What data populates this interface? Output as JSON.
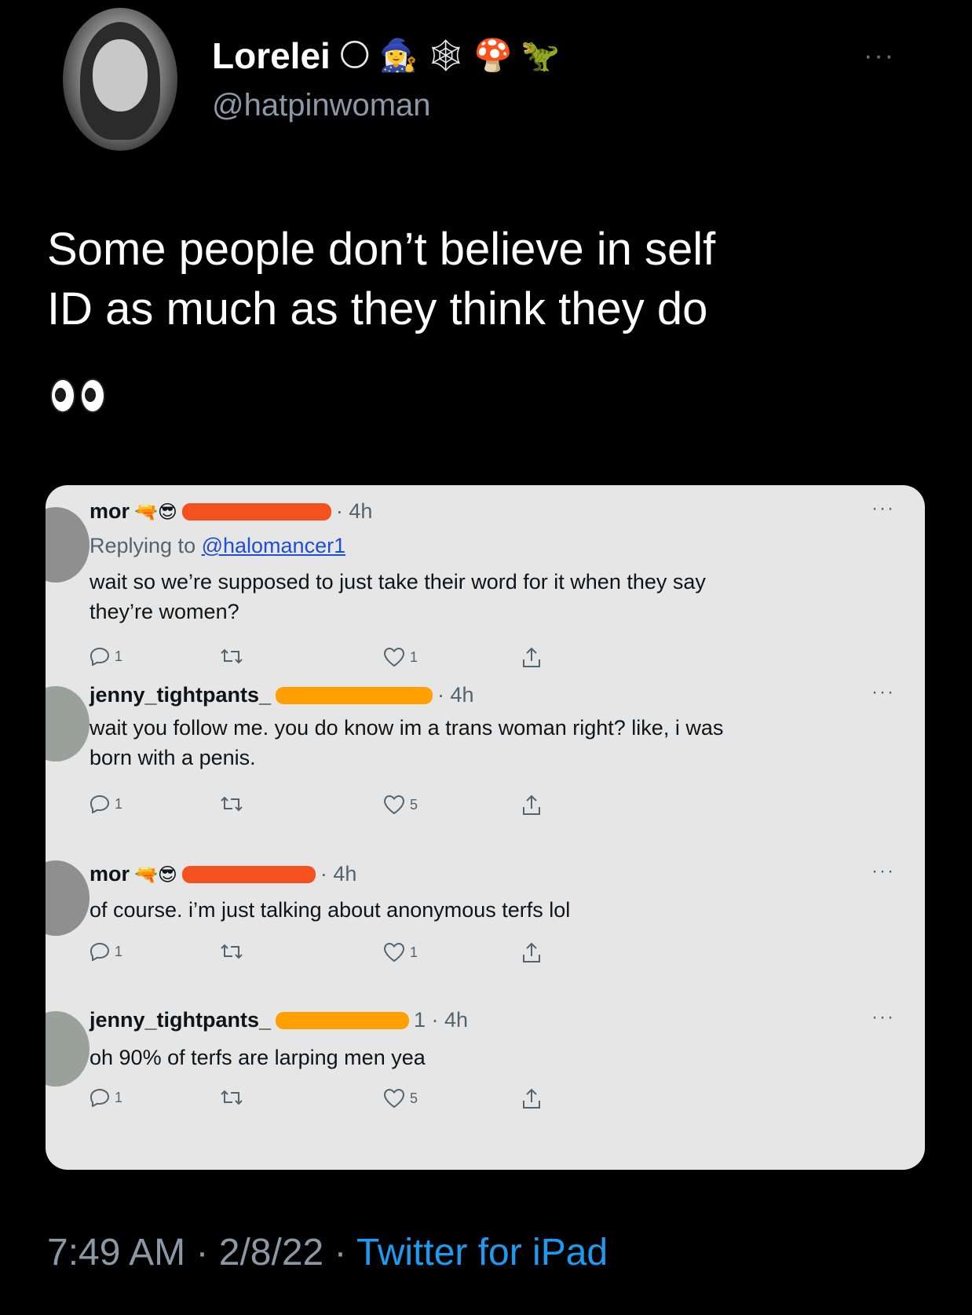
{
  "author": {
    "display_name": "Lorelei",
    "emojis": [
      "🌕",
      "🧙‍♀️",
      "🕸",
      "🍄",
      "🦖"
    ],
    "handle": "@hatpinwoman"
  },
  "more_label": "···",
  "tweet": {
    "text_line1": "Some people don’t believe in self",
    "text_line2": "ID as much as they think they do",
    "emoji": "👀"
  },
  "replies": [
    {
      "name": "mor",
      "name_emojis": "🔫😎",
      "redact_color": "#f4511e",
      "time": "· 4h",
      "replying_prefix": "Replying to ",
      "replying_handle": "@halomancer1",
      "line1": "wait so we’re supposed to just take their word for it when they say",
      "line2": "they’re women?",
      "replies": "1",
      "likes": "1"
    },
    {
      "name": "jenny_tightpants_",
      "name_emojis": "",
      "redact_color": "#ffa000",
      "time": "· 4h",
      "line1": "wait you follow me. you do know im a trans woman right? like, i was",
      "line2": "born with a penis.",
      "replies": "1",
      "likes": "5"
    },
    {
      "name": "mor",
      "name_emojis": "🔫😎",
      "redact_color": "#f4511e",
      "time": "· 4h",
      "line1": "of course. i’m just talking about anonymous terfs lol",
      "replies": "1",
      "likes": "1"
    },
    {
      "name": "jenny_tightpants_",
      "name_emojis": "",
      "redact_color": "#ffa000",
      "time": "1 · 4h",
      "line1": "oh 90% of terfs are larping men yea",
      "replies": "1",
      "likes": "5"
    }
  ],
  "footer": {
    "time": "7:49 AM",
    "date": "2/8/22",
    "separator": " · ",
    "source": "Twitter for iPad"
  },
  "colors": {
    "background": "#000000",
    "link": "#1d9bf0",
    "card": "#e6e6e6"
  },
  "icons": [
    "reply-icon",
    "retweet-icon",
    "like-icon",
    "share-icon"
  ]
}
